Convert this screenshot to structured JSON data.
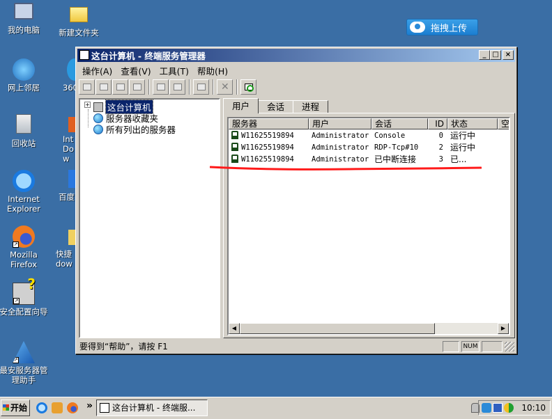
{
  "desktop": {
    "icons": [
      {
        "label": "我的电脑",
        "icon": "my-computer-icon"
      },
      {
        "label": "新建文件夹",
        "icon": "folder-icon"
      },
      {
        "label": "网上邻居",
        "icon": "network-places-icon"
      },
      {
        "label": "360",
        "icon": "360-icon"
      },
      {
        "label": "回收站",
        "icon": "recycle-bin-icon"
      },
      {
        "label": "Int Dow",
        "icon": "ie-download-icon"
      },
      {
        "label": "Internet Explorer",
        "icon": "internet-explorer-icon"
      },
      {
        "label": "百度",
        "icon": "baidu-icon"
      },
      {
        "label": "Mozilla Firefox",
        "icon": "firefox-icon"
      },
      {
        "label": "快捷 dow",
        "icon": "shortcut-icon"
      },
      {
        "label": "安全配置向导",
        "icon": "security-wizard-icon"
      },
      {
        "label": "最安服务器管理助手",
        "icon": "server-assistant-icon"
      }
    ],
    "upload_button": "拖拽上传"
  },
  "window": {
    "title": "这台计算机 - 终端服务管理器",
    "menu": [
      "操作(A)",
      "查看(V)",
      "工具(T)",
      "帮助(H)"
    ],
    "tree": {
      "root": "这台计算机",
      "children": [
        "服务器收藏夹",
        "所有列出的服务器"
      ]
    },
    "tabs": [
      "用户",
      "会话",
      "进程"
    ],
    "active_tab": "用户",
    "columns": [
      "服务器",
      "用户",
      "会话",
      "ID",
      "状态",
      "空"
    ],
    "rows": [
      {
        "server": "W11625519894",
        "user": "Administrator",
        "session": "Console",
        "id": "0",
        "state": "运行中"
      },
      {
        "server": "W11625519894",
        "user": "Administrator",
        "session": "RDP-Tcp#10",
        "id": "2",
        "state": "运行中"
      },
      {
        "server": "W11625519894",
        "user": "Administrator",
        "session": "已中断连接",
        "id": "3",
        "state": "已..."
      }
    ],
    "status": {
      "message": "要得到“帮助”，请按 F1",
      "num": "NUM"
    }
  },
  "taskbar": {
    "start": "开始",
    "task": "这台计算机 - 终端服...",
    "clock": "10:10",
    "chevron": "»"
  },
  "colors": {
    "desktop": "#3a6ea5",
    "title_start": "#0a246a",
    "title_end": "#a6caf0",
    "annotation": "#ff1a1a"
  }
}
